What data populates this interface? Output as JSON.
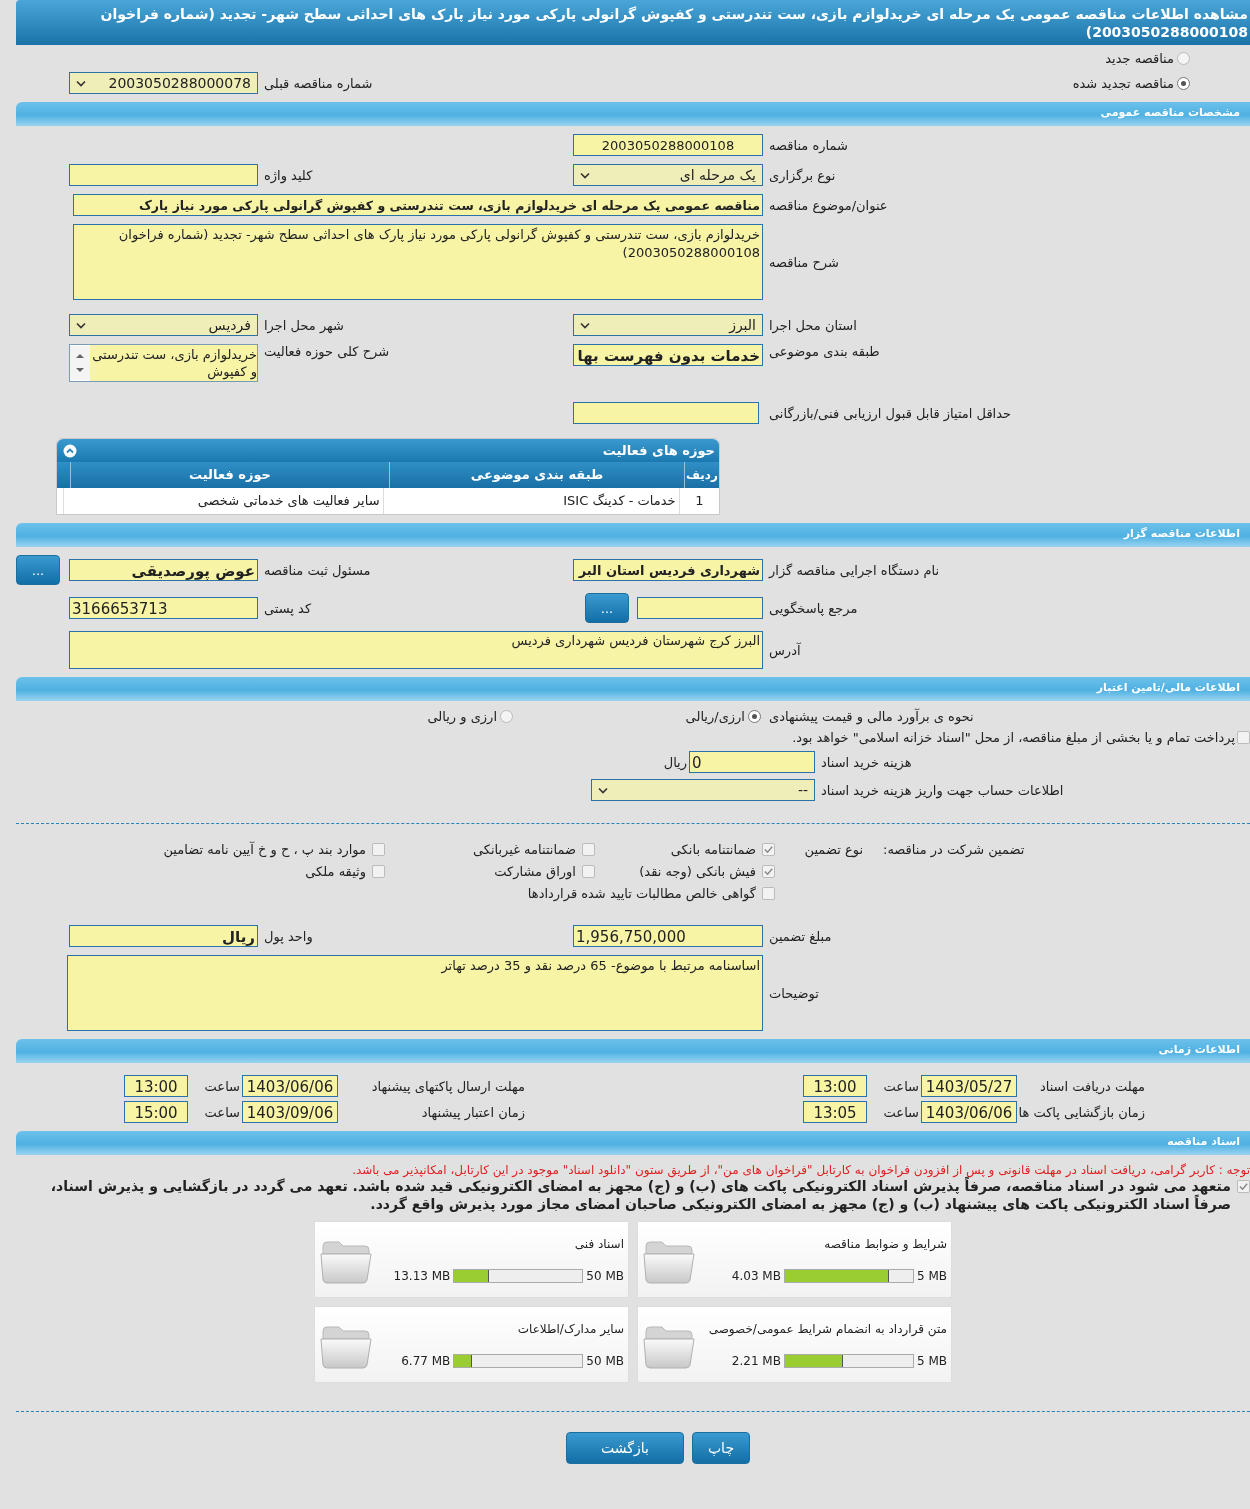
{
  "title": "مشاهده اطلاعات مناقصه عمومی یک مرحله ای خریدلوازم بازی، ست تندرستی و کفپوش گرانولی پارکی مورد نیاز پارک های احداثی سطح شهر- تجدید (شماره فراخوان 2003050288000108)",
  "tender_status": [
    {
      "label": "مناقصه جدید",
      "selected": false
    },
    {
      "label": "مناقصه تجدید شده",
      "selected": true
    }
  ],
  "previous_tender": {
    "label": "شماره مناقصه قبلی",
    "value": "2003050288000078"
  },
  "general": {
    "heading": "مشخصات مناقصه عمومی",
    "tender_number": {
      "label": "شماره مناقصه",
      "value": "2003050288000108"
    },
    "holding_type": {
      "label": "نوع برگزاری",
      "value": "یک مرحله ای"
    },
    "keyword": {
      "label": "کلید واژه"
    },
    "subject": {
      "label": "عنوان/موضوع مناقصه",
      "value": "مناقصه عمومی یک مرحله ای خریدلوازم بازی، ست تندرستی و کفپوش گرانولی پارکی مورد نیاز پارک"
    },
    "description": {
      "label": "شرح مناقصه",
      "value": "خریدلوازم بازی، ست تندرستی و کفپوش گرانولی پارکی مورد نیاز پارک های احداثی سطح شهر- تجدید (شماره فراخوان 2003050288000108)"
    },
    "province": {
      "label": "استان محل اجرا",
      "value": "البرز"
    },
    "city": {
      "label": "شهر محل اجرا",
      "value": "فردیس"
    },
    "category": {
      "label": "طبقه بندی موضوعی",
      "value": "خدمات بدون فهرست بها"
    },
    "activity_summary": {
      "label": "شرح کلی حوزه فعالیت",
      "value": "خریدلوازم بازی، ست تندرستی و کفپوش"
    },
    "min_score": {
      "label": "حداقل امتیاز قابل قبول ارزیابی فنی/بازرگانی"
    }
  },
  "activity_table": {
    "title": "حوزه های فعالیت",
    "columns": [
      "ردیف",
      "طبقه بندی موضوعی",
      "حوزه فعالیت"
    ],
    "rows": [
      [
        "1",
        "خدمات - کدینگ ISIC",
        "سایر فعالیت های خدماتی شخصی"
      ]
    ]
  },
  "organizer": {
    "heading": "اطلاعات مناقصه گزار",
    "agency": {
      "label": "نام دستگاه اجرایی مناقصه گزار",
      "value": "شهرداری فردیس استان البر"
    },
    "registrar": {
      "label": "مسئول ثبت مناقصه",
      "value": "عوض پورصدیقی",
      "button": "..."
    },
    "reference": {
      "label": "مرجع پاسخگویی",
      "button": "..."
    },
    "postal_code": {
      "label": "کد پستی",
      "value": "3166653713"
    },
    "address": {
      "label": "آدرس",
      "value": "البرز کرج شهرستان فردیس شهرداری فردیس"
    }
  },
  "financial": {
    "heading": "اطلاعات مالی/تامین اعتبار",
    "estimate": {
      "label": "نحوه ی برآورد مالی و قیمت پیشنهادی",
      "options": [
        {
          "label": "ارزی/ریالی",
          "selected": true
        },
        {
          "label": "ارزی و ریالی",
          "selected": false
        }
      ]
    },
    "treasury": {
      "label": "پرداخت تمام و یا بخشی از مبلغ مناقصه، از محل \"اسناد خزانه اسلامی\" خواهد بود.",
      "checked": false
    },
    "doc_fee": {
      "label": "هزینه خرید اسناد",
      "value": "0",
      "unit": "ریال"
    },
    "account": {
      "label": "اطلاعات حساب جهت واریز هزینه خرید اسناد",
      "value": "--"
    }
  },
  "guarantee": {
    "label": "تضمین شرکت در مناقصه:",
    "type_label": "نوع تضمین",
    "options": [
      {
        "label": "ضمانتنامه بانکی",
        "checked": true
      },
      {
        "label": "ضمانتنامه غیربانکی",
        "checked": false
      },
      {
        "label": "موارد بند پ ، ح و خ آیین نامه تضامین",
        "checked": false
      },
      {
        "label": "فیش بانکی (وجه نقد)",
        "checked": true
      },
      {
        "label": "اوراق مشارکت",
        "checked": false
      },
      {
        "label": "وثیقه ملکی",
        "checked": false
      },
      {
        "label": "گواهی خالص مطالبات تایید شده قراردادها",
        "checked": false
      }
    ],
    "amount": {
      "label": "مبلغ تضمین",
      "value": "1,956,750,000"
    },
    "currency": {
      "label": "واحد پول",
      "value": "ریال"
    },
    "notes": {
      "label": "توضیحات",
      "value": "اساسنامه مرتبط با موضوع- 65 درصد نقد و 35 درصد تهاتر"
    }
  },
  "timing": {
    "heading": "اطلاعات زمانی",
    "items": [
      {
        "label": "مهلت دریافت اسناد",
        "date": "1403/05/27",
        "time_label": "ساعت",
        "time": "13:00"
      },
      {
        "label": "مهلت ارسال پاکتهای پیشنهاد",
        "date": "1403/06/06",
        "time_label": "ساعت",
        "time": "13:00"
      },
      {
        "label": "زمان بازگشایی پاکت ها",
        "date": "1403/06/06",
        "time_label": "ساعت",
        "time": "13:05"
      },
      {
        "label": "زمان اعتبار پیشنهاد",
        "date": "1403/09/06",
        "time_label": "ساعت",
        "time": "15:00"
      }
    ]
  },
  "documents": {
    "heading": "اسناد مناقصه",
    "notice": "توجه : کاربر گرامی، دریافت اسناد در مهلت قانونی و پس از افزودن فراخوان به کارتابل \"فراخوان های من\"، از طریق ستون \"دانلود اسناد\" موجود در این کارتابل، امکانپذیر می باشد.",
    "commitment": {
      "text": "متعهد می شود در اسناد مناقصه، صرفاً پذیرش اسناد الکترونیکی پاکت های (ب) و (ج) مجهز به امضای الکترونیکی قید شده باشد. تعهد می گردد در بازگشایی و پذیرش اسناد، صرفاً اسناد الکترونیکی پاکت های پیشنهاد (ب) و (ج) مجهز به امضای الکترونیکی صاحبان امضای مجاز مورد پذیرش واقع گردد.",
      "checked": true
    },
    "files": [
      {
        "name": "شرایط و ضوابط مناقصه",
        "max": "5 MB",
        "size": "4.03 MB",
        "level": 0.81
      },
      {
        "name": "اسناد فنی",
        "max": "50 MB",
        "size": "13.13 MB",
        "level": 0.27
      },
      {
        "name": "متن قرارداد به انضمام شرایط عمومی/خصوصی",
        "max": "5 MB",
        "size": "2.21 MB",
        "level": 0.45
      },
      {
        "name": "سایر مدارک/اطلاعات",
        "max": "50 MB",
        "size": "6.77 MB",
        "level": 0.14
      }
    ]
  },
  "buttons": [
    {
      "label": "چاپ",
      "kind": "print"
    },
    {
      "label": "بازگشت",
      "kind": "back"
    }
  ]
}
